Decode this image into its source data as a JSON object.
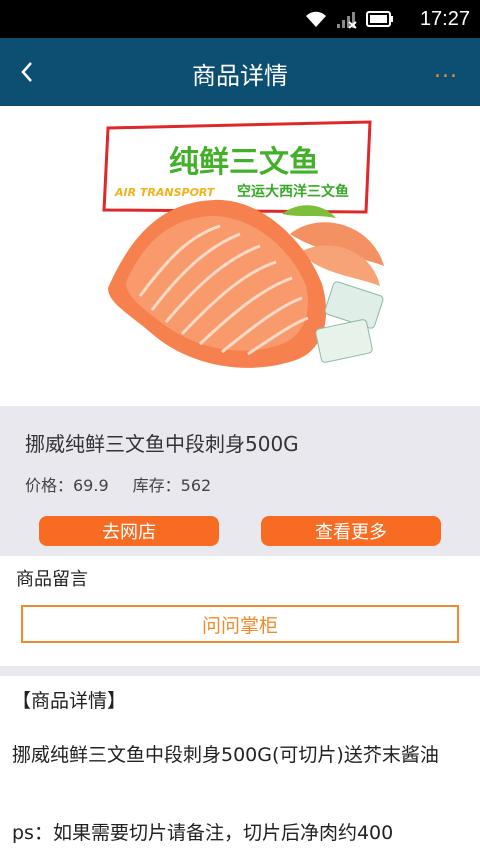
{
  "status_bar": {
    "time": "17:27"
  },
  "app_bar": {
    "title": "商品详情",
    "more_label": "..."
  },
  "hero": {
    "banner_title": "纯鲜三文鱼",
    "banner_subtitle_en": "AIR TRANSPORT",
    "banner_subtitle_cn": "空运大西洋三文鱼"
  },
  "product": {
    "name": "挪威纯鲜三文鱼中段刺身500G",
    "price": "价格：69.9",
    "stock": "库存：562",
    "go_shop_label": "去网店",
    "see_more_label": "查看更多"
  },
  "comments": {
    "label": "商品留言",
    "ask_label": "问问掌柜"
  },
  "details": {
    "heading": "【商品详情】",
    "paragraph1": "挪威纯鲜三文鱼中段刺身500G(可切片)送芥末酱油",
    "paragraph2": "ps：如果需要切片请备注，切片后净肉约400"
  },
  "colors": {
    "app_bar": "#0d4f73",
    "accent": "#f76b22",
    "outline": "#f08a2c",
    "panel": "#e9e8ee"
  }
}
